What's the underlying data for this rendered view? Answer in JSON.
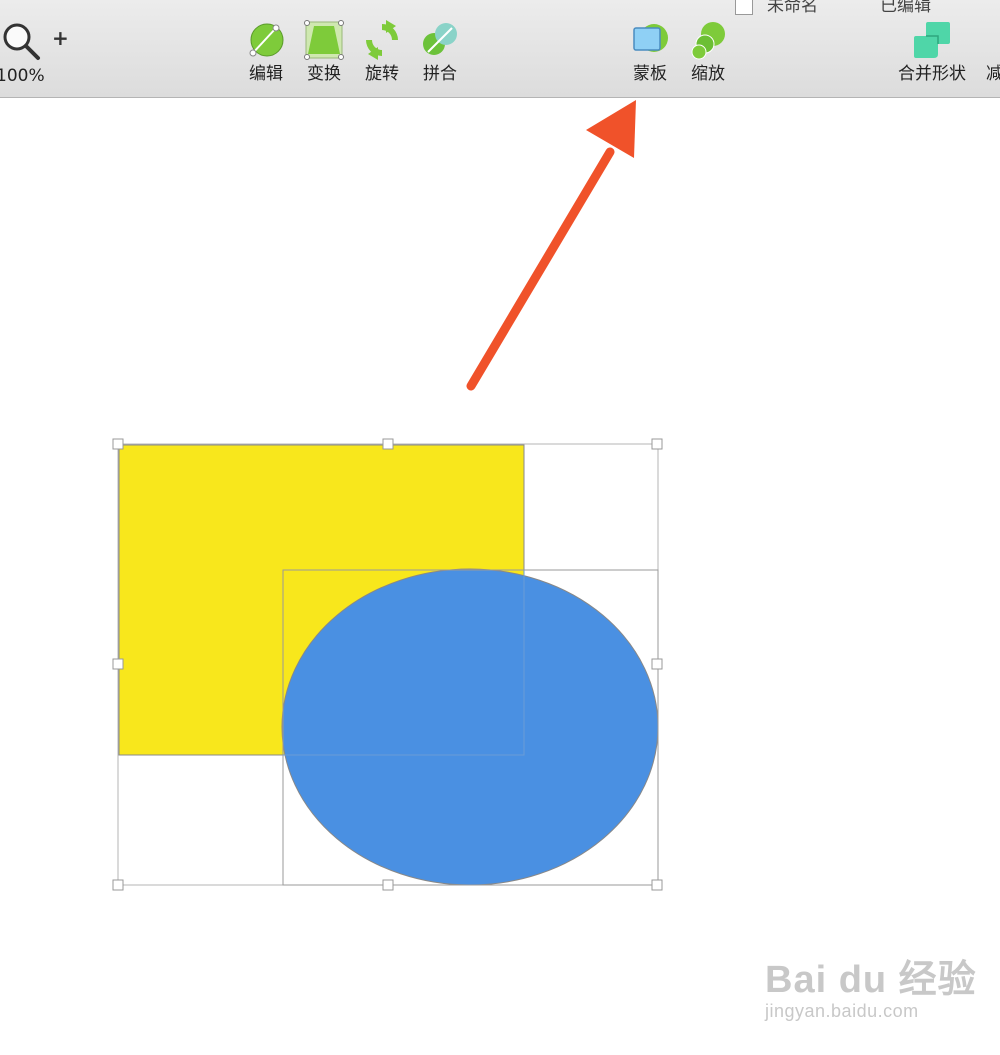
{
  "toolbar": {
    "zoom_level": "100%",
    "zoom_in_symbol": "+",
    "top_clip_left": "未命名",
    "top_clip_right": "已编辑",
    "tools": {
      "edit": {
        "label": "编辑",
        "icon": "edit-icon"
      },
      "transform": {
        "label": "变换",
        "icon": "transform-icon"
      },
      "rotate": {
        "label": "旋转",
        "icon": "rotate-icon"
      },
      "flatten": {
        "label": "拼合",
        "icon": "flatten-icon"
      },
      "mask": {
        "label": "蒙板",
        "icon": "mask-icon"
      },
      "scale": {
        "label": "缩放",
        "icon": "scale-icon"
      },
      "union": {
        "label": "合并形状",
        "icon": "union-icon"
      },
      "subtract": {
        "label": "减",
        "icon": "subtract-icon"
      }
    }
  },
  "canvas": {
    "rectangle_color": "#f8e71c",
    "oval_color": "#4a90e2",
    "arrow_color": "#f0522a",
    "selection_color": "#b4b4b4"
  },
  "watermark": {
    "logo_text": "Bai du 经验",
    "url": "jingyan.baidu.com"
  }
}
